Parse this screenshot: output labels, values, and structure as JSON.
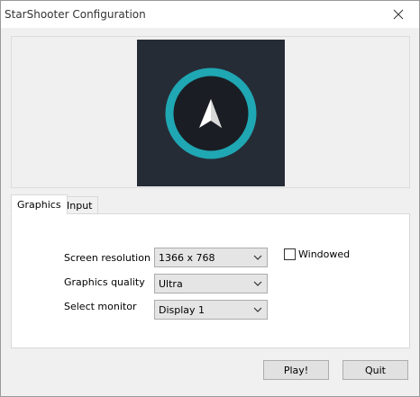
{
  "window": {
    "title": "StarShooter Configuration",
    "close_icon": "close-icon"
  },
  "banner": {
    "icon": "compass-arrow-icon",
    "bg_color": "#262c36",
    "ring_color": "#1fa7b3"
  },
  "tabs": [
    {
      "label": "Graphics",
      "active": true
    },
    {
      "label": "Input",
      "active": false
    }
  ],
  "graphics": {
    "resolution_label": "Screen resolution",
    "resolution_value": "1366 x 768",
    "quality_label": "Graphics quality",
    "quality_value": "Ultra",
    "monitor_label": "Select monitor",
    "monitor_value": "Display 1",
    "windowed_label": "Windowed",
    "windowed_checked": false
  },
  "buttons": {
    "play": "Play!",
    "quit": "Quit"
  }
}
